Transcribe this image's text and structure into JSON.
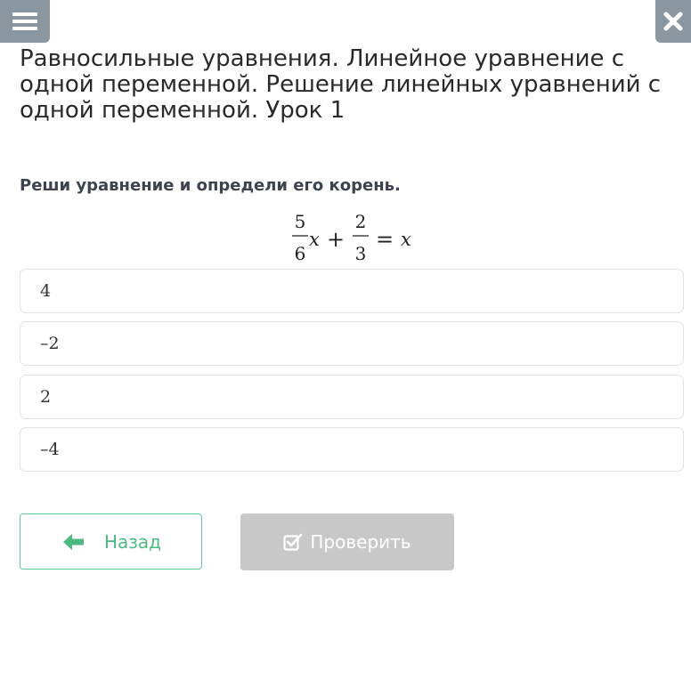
{
  "header": {
    "menu_icon": "hamburger-menu-icon",
    "close_icon": "close-icon",
    "button_color": "#8a96a0"
  },
  "lesson": {
    "title": "Равносильные уравнения. Линейное уравнение с одной переменной. Решение линейных уравнений с одной переменной. Урок 1"
  },
  "task": {
    "question": "Реши уравнение и определи его корень.",
    "equation": {
      "frac1_num": "5",
      "frac1_den": "6",
      "var1": "x",
      "plus": "+",
      "frac2_num": "2",
      "frac2_den": "3",
      "equals": "=",
      "var2": "x"
    }
  },
  "options": [
    {
      "value": "4"
    },
    {
      "value": "–2"
    },
    {
      "value": "2"
    },
    {
      "value": "–4"
    }
  ],
  "buttons": {
    "back_label": "Назад",
    "back_icon": "arrow-left-icon",
    "back_color": "#4cba80",
    "check_label": "Проверить",
    "check_icon": "checkbox-check-icon",
    "check_disabled": true,
    "check_color": "#c8c8c8"
  }
}
